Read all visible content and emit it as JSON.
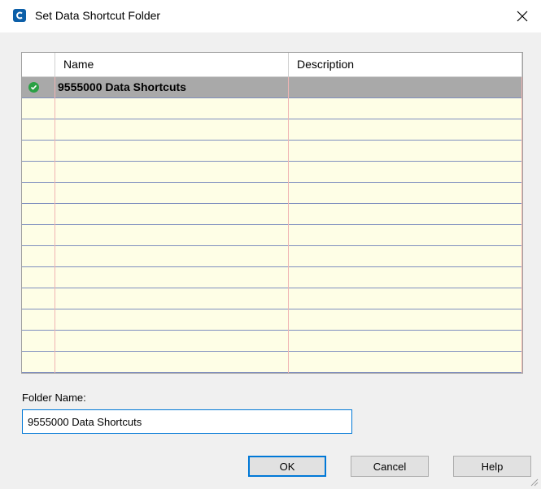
{
  "window": {
    "title": "Set Data Shortcut Folder"
  },
  "grid": {
    "columns": [
      "Name",
      "Description"
    ],
    "rows": [
      {
        "name": "9555000 Data Shortcuts",
        "description": "",
        "selected": true,
        "status": "check-icon"
      }
    ],
    "empty_row_count": 13
  },
  "folder": {
    "label": "Folder Name:",
    "value": "9555000 Data Shortcuts"
  },
  "buttons": {
    "ok": "OK",
    "cancel": "Cancel",
    "help": "Help"
  },
  "colors": {
    "grid_background": "#fefee6",
    "selected_row": "#a9a9a9",
    "row_line": "#7f8fbf",
    "column_line": "#f0b4b4",
    "accent": "#0078d7",
    "status_ok": "#2aa044"
  }
}
